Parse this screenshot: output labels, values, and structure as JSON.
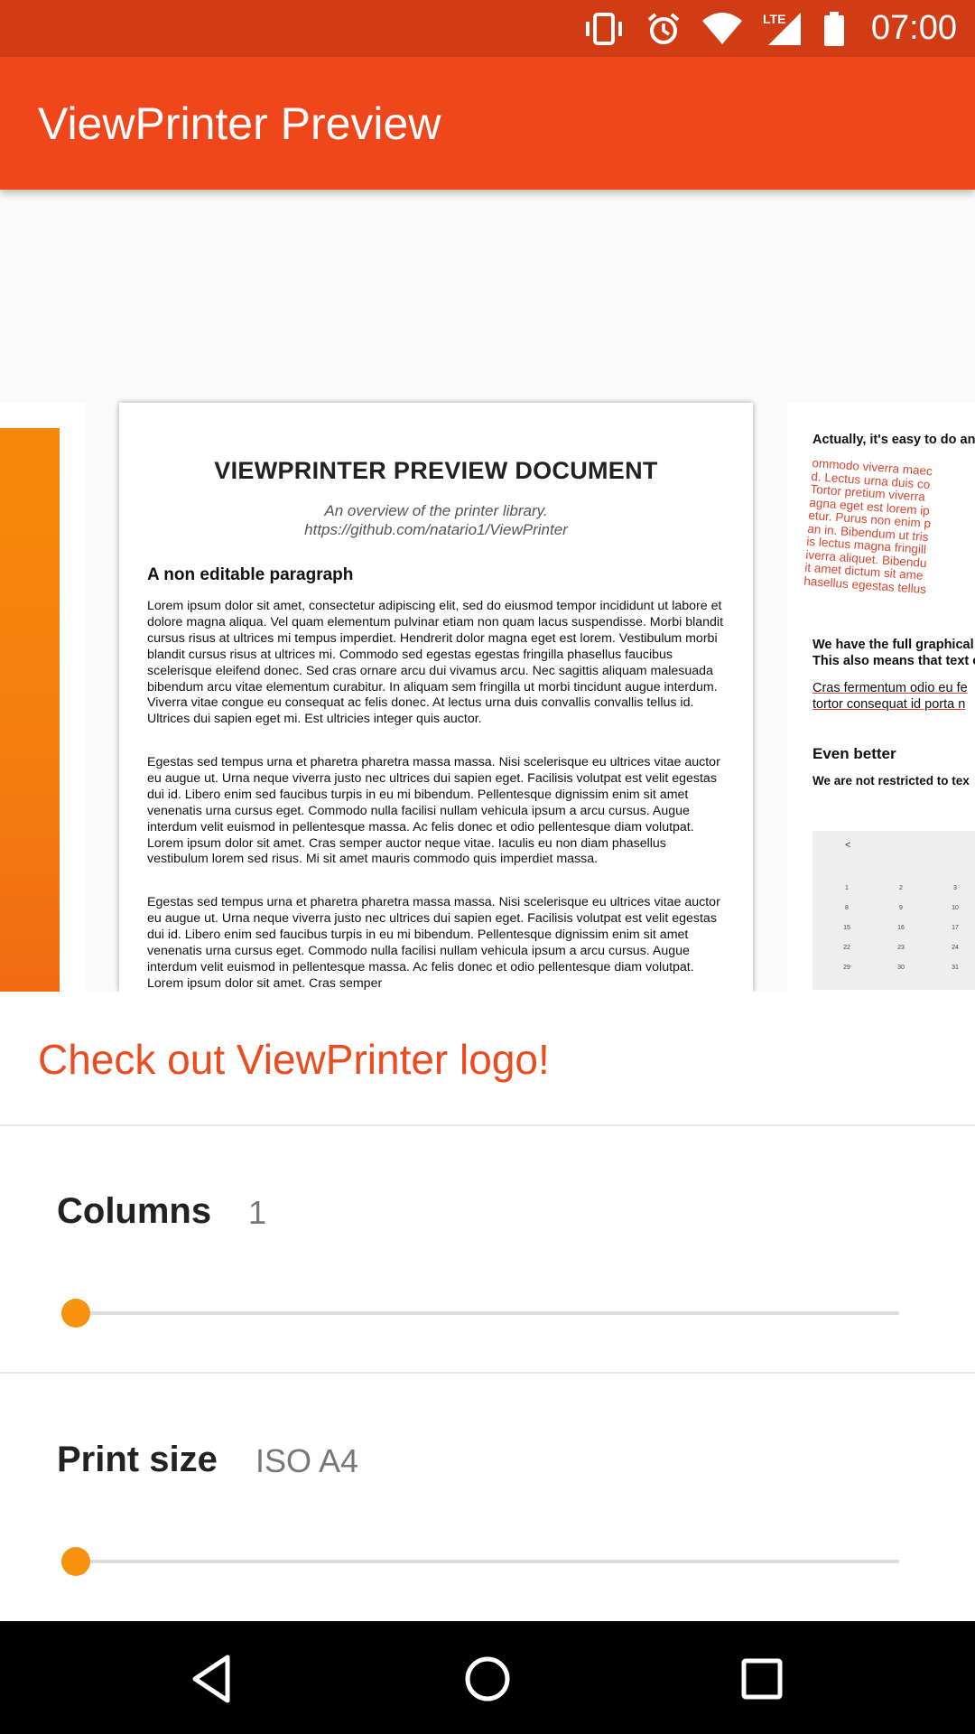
{
  "status_bar": {
    "time": "07:00",
    "icons": [
      "vibrate-icon",
      "alarm-icon",
      "wifi-icon",
      "lte-signal-icon",
      "battery-icon"
    ],
    "lte_label": "LTE"
  },
  "app_bar": {
    "title": "ViewPrinter Preview"
  },
  "preview": {
    "center_page": {
      "title": "VIEWPRINTER PREVIEW DOCUMENT",
      "subtitle_line1": "An overview of the printer library.",
      "subtitle_line2": "https://github.com/natario1/ViewPrinter",
      "heading": "A non editable paragraph",
      "paragraph1": "Lorem ipsum dolor sit amet, consectetur adipiscing elit, sed do eiusmod tempor incididunt ut labore et dolore magna aliqua. Vel quam elementum pulvinar etiam non quam lacus suspendisse. Morbi blandit cursus risus at ultrices mi tempus imperdiet. Hendrerit dolor magna eget est lorem. Vestibulum morbi blandit cursus risus at ultrices mi. Commodo sed egestas egestas fringilla phasellus faucibus scelerisque eleifend donec. Sed cras ornare arcu dui vivamus arcu. Nec sagittis aliquam malesuada bibendum arcu vitae elementum curabitur. In aliquam sem fringilla ut morbi tincidunt augue interdum. Viverra vitae congue eu consequat ac felis donec. At lectus urna duis convallis convallis tellus id. Ultrices dui sapien eget mi. Est ultricies integer quis auctor.",
      "paragraph2": "Egestas sed tempus urna et pharetra pharetra massa massa. Nisi scelerisque eu ultrices vitae auctor eu augue ut. Urna neque viverra justo nec ultrices dui sapien eget. Facilisis volutpat est velit egestas dui id. Libero enim sed faucibus turpis in eu mi bibendum. Pellentesque dignissim enim sit amet venenatis urna cursus eget. Commodo nulla facilisi nullam vehicula ipsum a arcu cursus. Augue interdum velit euismod in pellentesque massa. Ac felis donec et odio pellentesque diam volutpat. Lorem ipsum dolor sit amet. Cras semper auctor neque vitae. Iaculis eu non diam phasellus vestibulum lorem sed risus. Mi sit amet mauris commodo quis imperdiet massa.",
      "paragraph3": "Egestas sed tempus urna et pharetra pharetra massa massa. Nisi scelerisque eu ultrices vitae auctor eu augue ut. Urna neque viverra justo nec ultrices dui sapien eget. Facilisis volutpat est velit egestas dui id. Libero enim sed faucibus turpis in eu mi bibendum. Pellentesque dignissim enim sit amet venenatis urna cursus eget. Commodo nulla facilisi nullam vehicula ipsum a arcu cursus. Augue interdum velit euismod in pellentesque massa. Ac felis donec et odio pellentesque diam volutpat. Lorem ipsum dolor sit amet. Cras semper"
    },
    "right_page": {
      "line1": "Actually, it's easy to do any",
      "red_lines": [
        "ommodo viverra maec",
        "d. Lectus urna duis co",
        "Tortor pretium viverra",
        "agna eget est lorem ip",
        "etur. Purus non enim p",
        "an in. Bibendum ut tris",
        "is lectus magna fringill",
        "iverra aliquet. Bibendu",
        "it amet dictum sit ame",
        "hasellus egestas tellus"
      ],
      "bold_line1": "We have the full graphical",
      "bold_line2": "This also means that text c",
      "edit_line1": "Cras fermentum odio eu fe",
      "edit_line2": "tortor consequat id porta n",
      "heading": "Even better",
      "bold_line3": "We are not restricted to tex",
      "calendar_back": "<",
      "calendar_days": [
        "1",
        "2",
        "3",
        "8",
        "9",
        "10",
        "15",
        "16",
        "17",
        "22",
        "23",
        "24",
        "29",
        "30",
        "31"
      ]
    }
  },
  "panel": {
    "logo_link": "Check out ViewPrinter logo!",
    "columns": {
      "label": "Columns",
      "value": "1",
      "slider_fraction": 0.0
    },
    "print_size": {
      "label": "Print size",
      "value": "ISO A4",
      "slider_fraction": 0.0
    }
  },
  "nav_bar": {
    "buttons": [
      "back-icon",
      "home-icon",
      "recents-icon"
    ]
  },
  "colors": {
    "status_bar": "#d23c15",
    "app_bar": "#ef461b",
    "accent_text": "#ec4a1f",
    "slider_thumb": "#f7920e"
  }
}
